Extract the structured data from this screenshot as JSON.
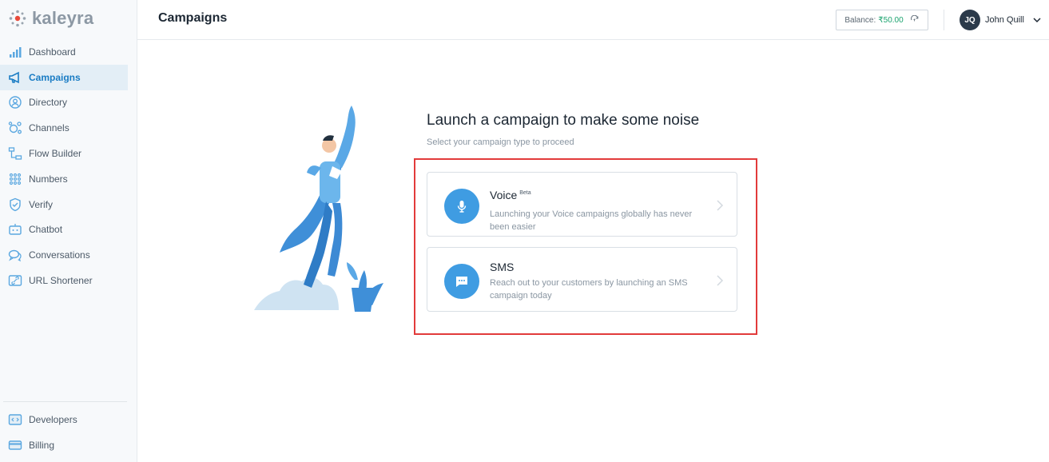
{
  "brand": {
    "name": "kaleyra",
    "color": "#e84a3b"
  },
  "sidebar": {
    "items": [
      {
        "label": "Dashboard",
        "icon": "bar-chart-icon"
      },
      {
        "label": "Campaigns",
        "icon": "megaphone-icon",
        "active": true
      },
      {
        "label": "Directory",
        "icon": "contact-icon"
      },
      {
        "label": "Channels",
        "icon": "channels-icon"
      },
      {
        "label": "Flow Builder",
        "icon": "flow-icon"
      },
      {
        "label": "Numbers",
        "icon": "dialpad-icon"
      },
      {
        "label": "Verify",
        "icon": "shield-icon"
      },
      {
        "label": "Chatbot",
        "icon": "bot-icon"
      },
      {
        "label": "Conversations",
        "icon": "chat-bubbles-icon"
      },
      {
        "label": "URL Shortener",
        "icon": "link-icon"
      }
    ],
    "bottom_items": [
      {
        "label": "Developers",
        "icon": "code-icon"
      },
      {
        "label": "Billing",
        "icon": "card-icon"
      }
    ]
  },
  "header": {
    "title": "Campaigns",
    "balance_label": "Balance:",
    "balance_amount": "₹50.00",
    "user_initials": "JQ",
    "user_name": "John Quill"
  },
  "main": {
    "headline": "Launch a campaign to make some noise",
    "subline": "Select your campaign type to proceed",
    "cards": [
      {
        "title": "Voice",
        "badge": "Beta",
        "description": "Launching your Voice campaigns globally has never been easier",
        "icon": "microphone-icon"
      },
      {
        "title": "SMS",
        "description": "Reach out to your customers by launching an SMS campaign today",
        "icon": "message-icon"
      }
    ]
  },
  "colors": {
    "accent": "#3f9ce2",
    "active_nav": "#1a7cc4",
    "highlight": "#e23b3b",
    "balance_green": "#1aa36e"
  }
}
